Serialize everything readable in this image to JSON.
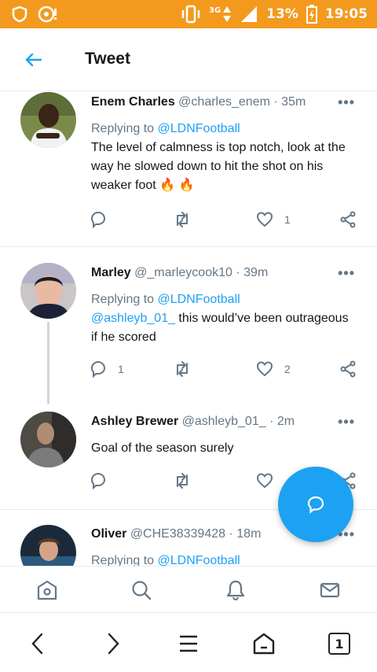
{
  "status_bar": {
    "network": "3G",
    "battery": "13%",
    "time": "19:05"
  },
  "header": {
    "title": "Tweet"
  },
  "tweets": [
    {
      "name": "Enem Charles",
      "handle": "@charles_enem",
      "sep": "·",
      "time": "35m",
      "reply_prefix": "Replying to",
      "reply_to": "@LDNFootball",
      "text": "The level of calmness is top notch, look at the way he slowed down to hit the shot on his weaker foot",
      "emoji": "🔥 🔥",
      "reply_count": "",
      "retweet_count": "",
      "like_count": "1"
    },
    {
      "name": "Marley",
      "handle": "@_marleycook10",
      "sep": "·",
      "time": "39m",
      "reply_prefix": "Replying to",
      "reply_to": "@LDNFootball",
      "mention": "@ashleyb_01_",
      "text": " this would’ve been outrageous if he scored",
      "reply_count": "1",
      "retweet_count": "",
      "like_count": "2"
    },
    {
      "name": "Ashley Brewer",
      "handle": "@ashleyb_01_",
      "sep": "·",
      "time": "2m",
      "text": "Goal of the season surely",
      "reply_count": "",
      "retweet_count": "",
      "like_count": ""
    },
    {
      "name": "Oliver",
      "handle": "@CHE38339428",
      "sep": "·",
      "time": "18m",
      "reply_prefix": "Replying to",
      "reply_to": "@LDNFootball"
    }
  ],
  "bottom_nav": [
    "home-icon",
    "search-icon",
    "notifications-icon",
    "messages-icon"
  ],
  "browser_bar": {
    "tab_count": "1"
  },
  "colors": {
    "status_bar": "#f39a1e",
    "accent": "#1da1f2",
    "secondary_text": "#657786"
  }
}
